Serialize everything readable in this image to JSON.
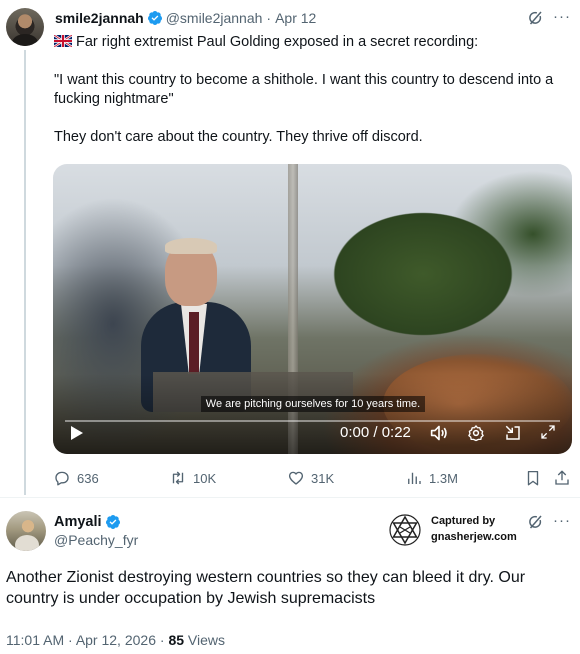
{
  "original_tweet": {
    "name": "smile2jannah",
    "handle": "@smile2jannah",
    "separator": "·",
    "date": "Apr 12",
    "text_line1": "Far right extremist Paul Golding exposed in a secret recording:",
    "flag_emoji": "uk-flag",
    "quote": "\"I want this country to become a shithole. I want this country to descend into a fucking nightmare\"",
    "comment": "They don't care about the country. They thrive off discord.",
    "video": {
      "subtitle": "We are pitching ourselves for 10 years time.",
      "time": "0:00 / 0:22",
      "progress": 0.0
    },
    "actions": {
      "replies": "636",
      "reposts": "10K",
      "likes": "31K",
      "views": "1.3M"
    }
  },
  "reply_tweet": {
    "name": "Amyali",
    "handle": "@Peachy_fyr",
    "text": "Another Zionist destroying western countries so they can bleed it dry. Our country is under occupation by Jewish supremacists",
    "time": "11:01 AM",
    "separator": "·",
    "date": "Apr 12, 2026",
    "separator2": "·",
    "views_count": "85",
    "views_label": "Views"
  },
  "stamp": {
    "line1": "Captured by",
    "line2": "gnasherjew.com"
  },
  "colors": {
    "verified_blue": "#1d9bf0",
    "secondary_text": "#536471",
    "primary_text": "#0f1419"
  },
  "icons": {
    "more": "···"
  }
}
